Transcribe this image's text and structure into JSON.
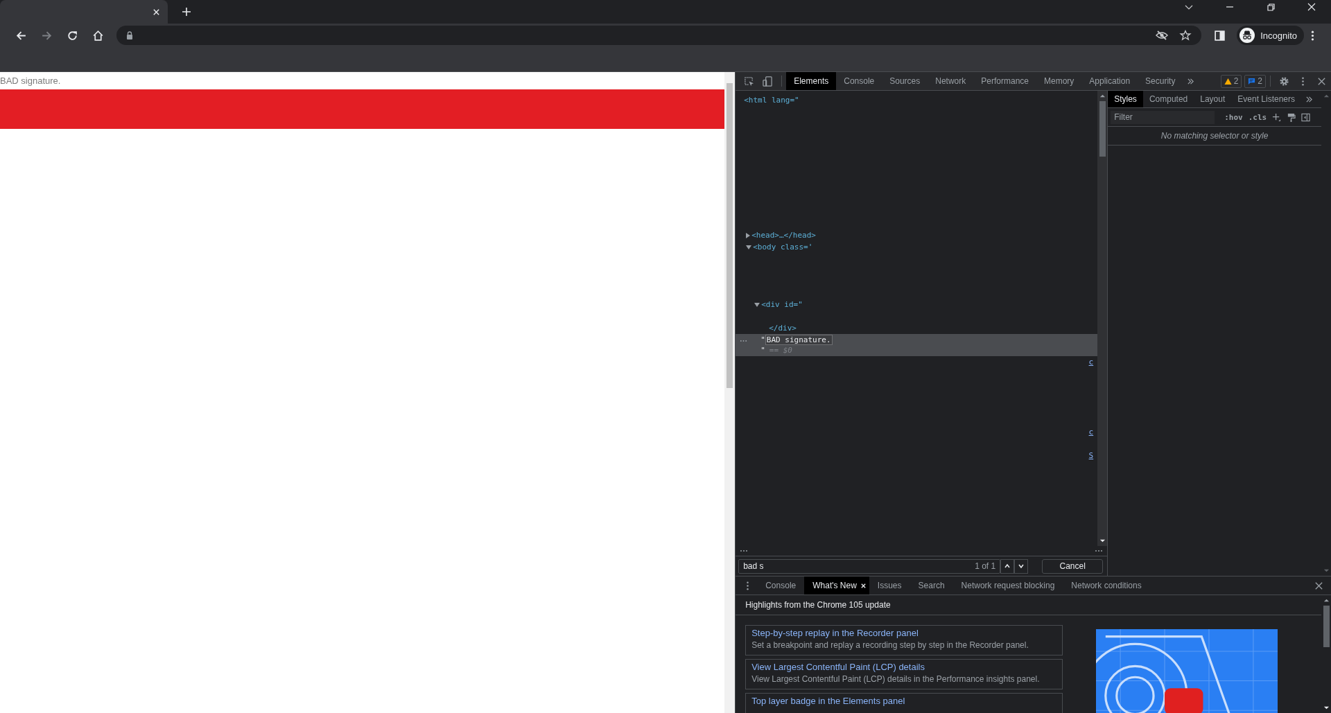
{
  "browser": {
    "profile": "Incognito"
  },
  "page": {
    "message": "BAD signature."
  },
  "devtools": {
    "tabs": [
      {
        "label": "Elements",
        "selected": true
      },
      {
        "label": "Console",
        "selected": false
      },
      {
        "label": "Sources",
        "selected": false
      },
      {
        "label": "Network",
        "selected": false
      },
      {
        "label": "Performance",
        "selected": false
      },
      {
        "label": "Memory",
        "selected": false
      },
      {
        "label": "Application",
        "selected": false
      },
      {
        "label": "Security",
        "selected": false
      }
    ],
    "warnings": "2",
    "messages": "2",
    "elements_tree": [
      {
        "kind": "element",
        "label": "<html lang=\"",
        "selected": false,
        "children": [
          {
            "kind": "element",
            "label": "<head>…</head>",
            "expanded": false,
            "selected": false
          },
          {
            "kind": "element",
            "label": "<body class='",
            "expanded": true,
            "selected": false,
            "children": [
              {
                "kind": "element",
                "label": "<div id=\"",
                "expanded": true,
                "close": "</div>",
                "selected": false
              },
              {
                "kind": "text",
                "quote": "\"",
                "match": "BAD signature.",
                "end": "\"",
                "console_ref": "== $0",
                "selected": true
              }
            ]
          }
        ]
      }
    ],
    "source_links": [
      "c",
      "c",
      "S"
    ],
    "styles_pane": {
      "tabs": [
        {
          "label": "Styles",
          "selected": true
        },
        {
          "label": "Computed",
          "selected": false
        },
        {
          "label": "Layout",
          "selected": false
        },
        {
          "label": "Event Listeners",
          "selected": false
        }
      ],
      "filter": {
        "placeholder": "Filter"
      },
      "hov": ":hov",
      "cls": ".cls",
      "empty_message": "No matching selector or style"
    },
    "search": {
      "value": "bad s",
      "count": "1 of 1",
      "cancel": "Cancel"
    },
    "drawer": {
      "tabs": [
        {
          "label": "Console",
          "selected": false,
          "closable": false
        },
        {
          "label": "What's New",
          "selected": true,
          "closable": true
        },
        {
          "label": "Issues",
          "selected": false,
          "closable": false
        },
        {
          "label": "Search",
          "selected": false,
          "closable": false
        },
        {
          "label": "Network request blocking",
          "selected": false,
          "closable": false
        },
        {
          "label": "Network conditions",
          "selected": false,
          "closable": false
        }
      ],
      "heading": "Highlights from the Chrome 105 update",
      "cards": [
        {
          "title": "Step-by-step replay in the Recorder panel",
          "description": "Set a breakpoint and replay a recording step by step in the Recorder panel."
        },
        {
          "title": "View Largest Contentful Paint (LCP) details",
          "description": "View Largest Contentful Paint (LCP) details in the Performance insights panel."
        },
        {
          "title": "Top layer badge in the Elements panel"
        }
      ]
    }
  }
}
